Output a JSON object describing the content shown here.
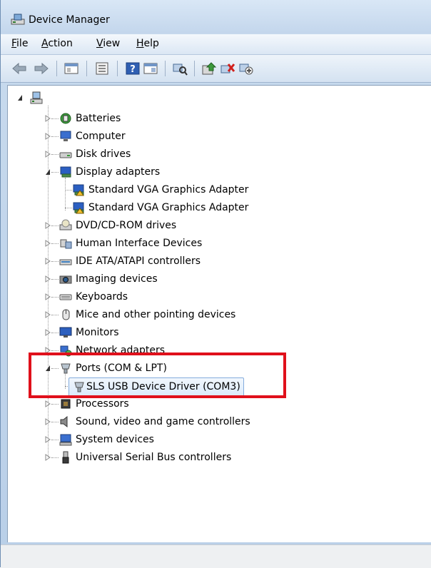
{
  "window": {
    "title": "Device Manager"
  },
  "menu": [
    {
      "label": "File",
      "accel": "F",
      "rest": "ile"
    },
    {
      "label": "Action",
      "accel": "A",
      "rest": "ction"
    },
    {
      "label": "View",
      "accel": "V",
      "rest": "iew"
    },
    {
      "label": "Help",
      "accel": "H",
      "rest": "elp"
    }
  ],
  "toolbar": {
    "buttons": [
      "back-icon",
      "forward-icon",
      "properties-pane-icon",
      "show-hide-icon",
      "help-icon",
      "console-tree-icon",
      "scan-hardware-icon",
      "update-driver-icon",
      "uninstall-icon",
      "disable-icon"
    ]
  },
  "tree": {
    "root_icon": "computer-icon",
    "categories": [
      {
        "label": "Batteries",
        "icon": "battery-icon",
        "expanded": false
      },
      {
        "label": "Computer",
        "icon": "computer-icon",
        "expanded": false
      },
      {
        "label": "Disk drives",
        "icon": "disk-drive-icon",
        "expanded": false
      },
      {
        "label": "Display adapters",
        "icon": "display-adapter-icon",
        "expanded": true,
        "children": [
          "Standard VGA Graphics Adapter",
          "Standard VGA Graphics Adapter"
        ]
      },
      {
        "label": "DVD/CD-ROM drives",
        "icon": "dvd-drive-icon",
        "expanded": false
      },
      {
        "label": "Human Interface Devices",
        "icon": "hid-icon",
        "expanded": false
      },
      {
        "label": "IDE ATA/ATAPI controllers",
        "icon": "ide-controller-icon",
        "expanded": false
      },
      {
        "label": "Imaging devices",
        "icon": "camera-icon",
        "expanded": false
      },
      {
        "label": "Keyboards",
        "icon": "keyboard-icon",
        "expanded": false
      },
      {
        "label": "Mice and other pointing devices",
        "icon": "mouse-icon",
        "expanded": false
      },
      {
        "label": "Monitors",
        "icon": "monitor-icon",
        "expanded": false
      },
      {
        "label": "Network adapters",
        "icon": "network-adapter-icon",
        "expanded": false
      },
      {
        "label": "Ports (COM & LPT)",
        "icon": "port-icon",
        "expanded": true,
        "children": [
          "SLS USB Device Driver (COM3)"
        ]
      },
      {
        "label": "Processors",
        "icon": "processor-icon",
        "expanded": false
      },
      {
        "label": "Sound, video and game controllers",
        "icon": "speaker-icon",
        "expanded": false
      },
      {
        "label": "System devices",
        "icon": "system-device-icon",
        "expanded": false
      },
      {
        "label": "Universal Serial Bus controllers",
        "icon": "usb-icon",
        "expanded": false
      }
    ]
  },
  "colors": {
    "highlight_box": "#e0101b",
    "selection": "#dbeafb"
  }
}
